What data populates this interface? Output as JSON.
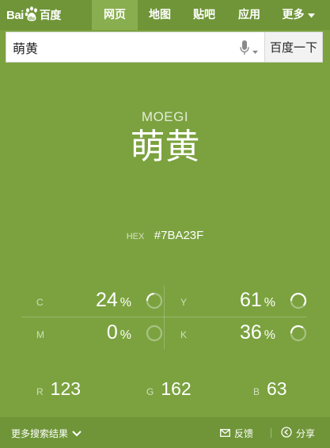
{
  "header": {
    "logo": {
      "left": "Bai",
      "right": "百度"
    },
    "nav": [
      "网页",
      "地图",
      "贴吧",
      "应用",
      "更多"
    ],
    "active_nav": "网页"
  },
  "search": {
    "query": "萌黄",
    "button_label": "百度一下"
  },
  "color": {
    "romaji": "MOEGI",
    "name": "萌黄",
    "hex_label": "HEX",
    "hex": "#7BA23F",
    "cmyk": [
      {
        "label": "C",
        "value": "24",
        "unit": "%"
      },
      {
        "label": "Y",
        "value": "61",
        "unit": "%"
      },
      {
        "label": "M",
        "value": "0",
        "unit": "%"
      },
      {
        "label": "K",
        "value": "36",
        "unit": "%"
      }
    ],
    "rgb": [
      {
        "label": "R",
        "value": "123"
      },
      {
        "label": "G",
        "value": "162"
      },
      {
        "label": "B",
        "value": "63"
      }
    ]
  },
  "footer": {
    "more_results": "更多搜索结果",
    "feedback": "反馈",
    "share": "分享"
  },
  "colors": {
    "background": "#7BA23F",
    "bar": "#6f9538",
    "active_tab": "#88ae4f"
  },
  "icons": {
    "logo": "baidu-paw-icon",
    "mic": "microphone-icon",
    "more": "chevron-down-icon",
    "feedback": "mail-icon",
    "share": "share-icon"
  }
}
